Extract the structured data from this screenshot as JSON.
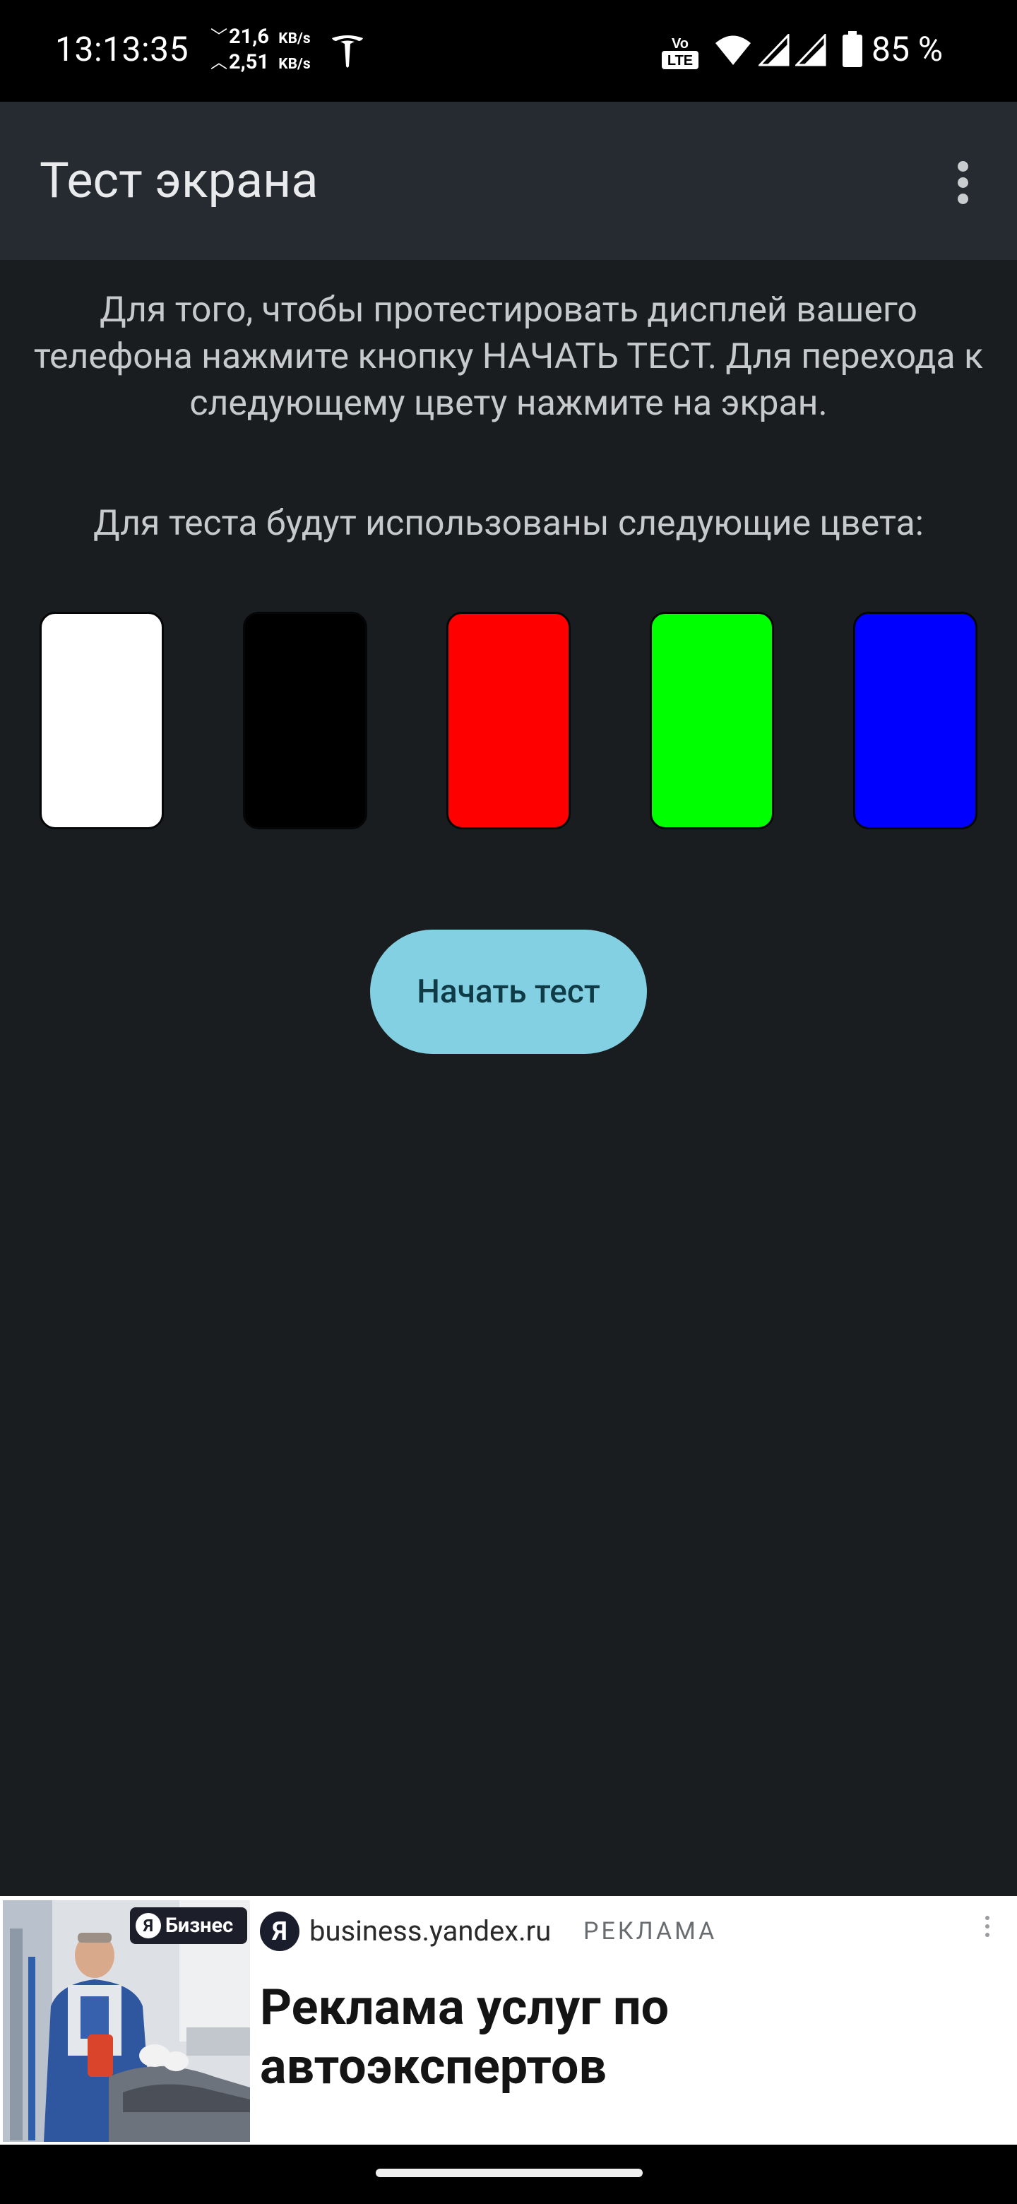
{
  "status_bar": {
    "time": "13:13:35",
    "download_speed": "21,6",
    "upload_speed": "2,51",
    "speed_unit": "KB/s",
    "down_arrow": "﹀",
    "up_arrow": "︿",
    "volte_label_top": "Vo",
    "volte_label_bottom": "LTE",
    "battery": "85 %"
  },
  "app_bar": {
    "title": "Тест экрана",
    "menu_icon": "more-vert-icon"
  },
  "content": {
    "intro": "Для того, чтобы протестировать дисплей вашего телефона нажмите кнопку НАЧАТЬ ТЕСТ. Для перехода к следующему цвету нажмите на экран.",
    "colors_caption": "Для теста будут использованы следующие цвета:",
    "test_colors": [
      {
        "name": "white",
        "hex": "#ffffff"
      },
      {
        "name": "black",
        "hex": "#000000"
      },
      {
        "name": "red",
        "hex": "#ff0000"
      },
      {
        "name": "green",
        "hex": "#00ff00"
      },
      {
        "name": "blue",
        "hex": "#0000ff"
      }
    ],
    "start_button": "Начать тест"
  },
  "ad": {
    "brand_badge": "Бизнес",
    "brand_letter": "Я",
    "source_letter": "Я",
    "domain": "business.yandex.ru",
    "label": "РЕКЛАМА",
    "headline": "Реклама услуг по автоэкспертов"
  },
  "colors": {
    "background": "#1a1d20",
    "app_bar": "#252b30",
    "accent_button": "#84d0e3",
    "button_text": "#0f3b47"
  }
}
